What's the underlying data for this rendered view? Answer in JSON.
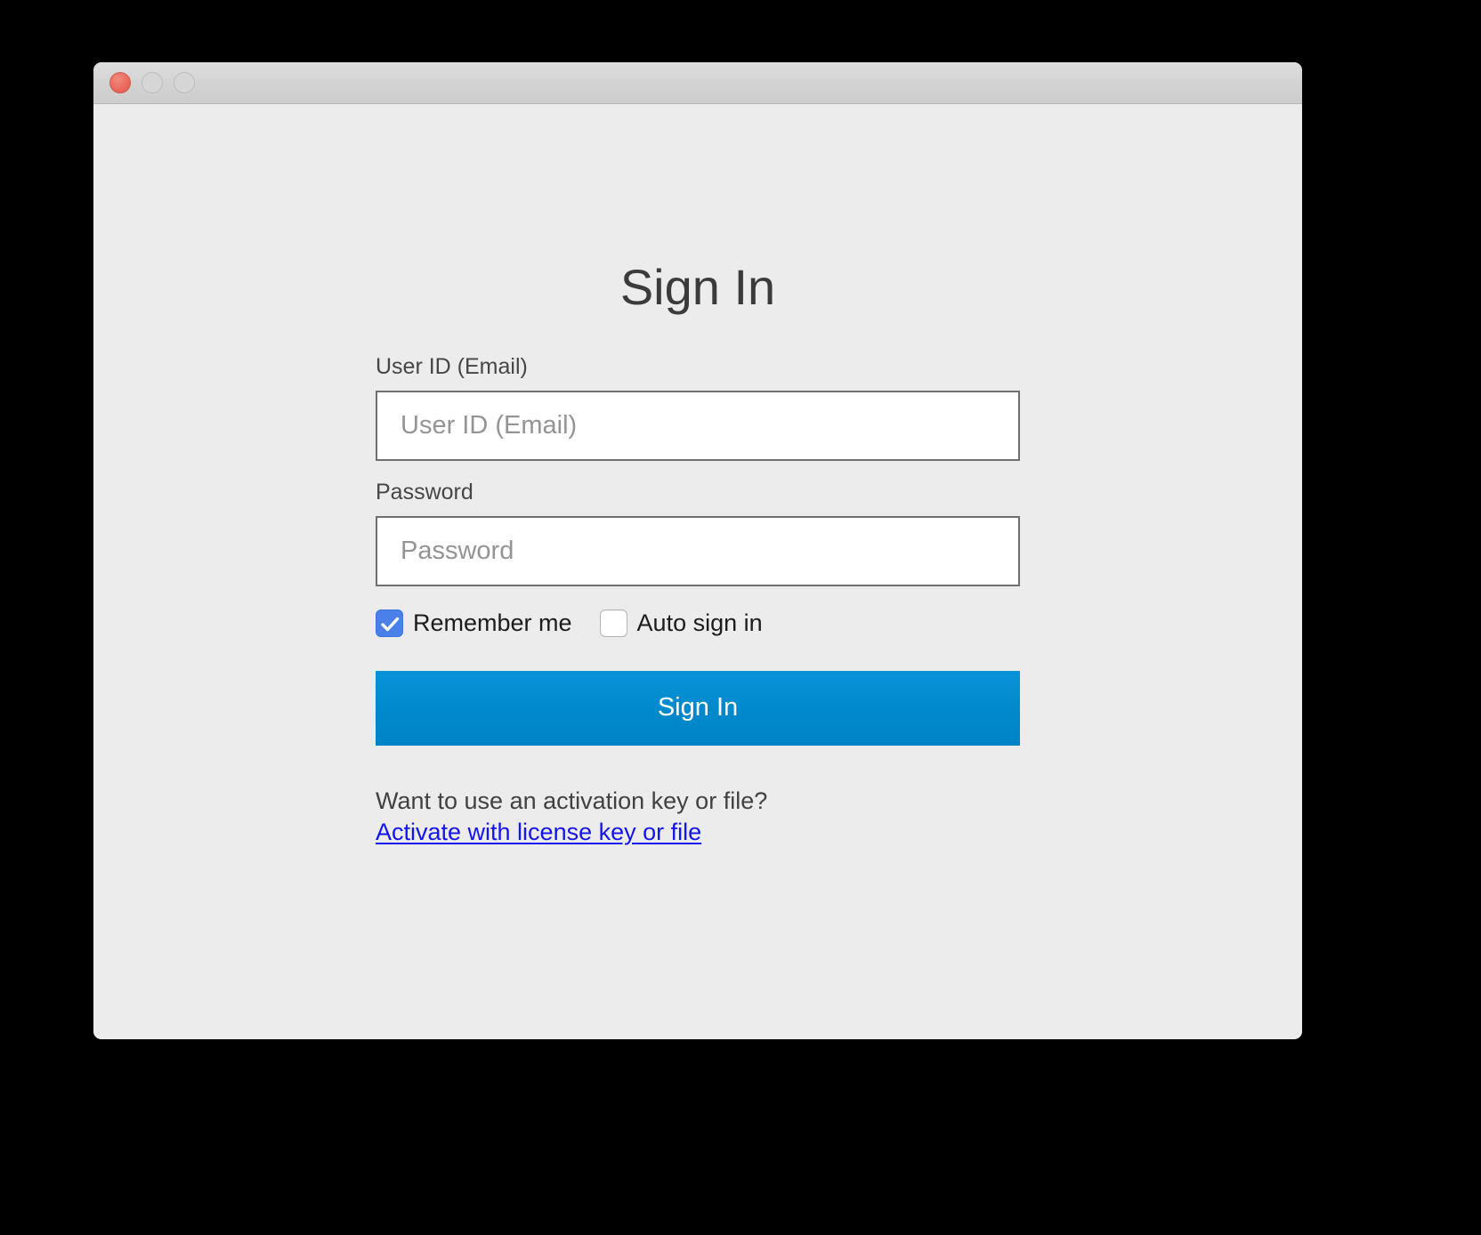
{
  "window": {
    "traffic_lights": [
      {
        "name": "close",
        "state": "enabled"
      },
      {
        "name": "minimize",
        "state": "disabled"
      },
      {
        "name": "zoom",
        "state": "disabled"
      }
    ]
  },
  "signin": {
    "title": "Sign In",
    "userid": {
      "label": "User ID (Email)",
      "placeholder": "User ID (Email)",
      "value": ""
    },
    "password": {
      "label": "Password",
      "placeholder": "Password",
      "value": ""
    },
    "remember_me": {
      "label": "Remember me",
      "checked": true
    },
    "auto_sign_in": {
      "label": "Auto sign in",
      "checked": false
    },
    "submit_label": "Sign In",
    "activation_prompt": "Want to use an activation key or file?",
    "activation_link": "Activate with license key or file"
  },
  "colors": {
    "window_background": "#ececec",
    "titlebar": "#d6d6d6",
    "desktop": "#000000",
    "primary_button": "#0089ce",
    "checkbox_checked": "#4a80e8",
    "link": "#1414ee",
    "input_border": "#6f6f6f",
    "title_text": "#3b3b3b",
    "close_light": "#ec6a5e"
  }
}
